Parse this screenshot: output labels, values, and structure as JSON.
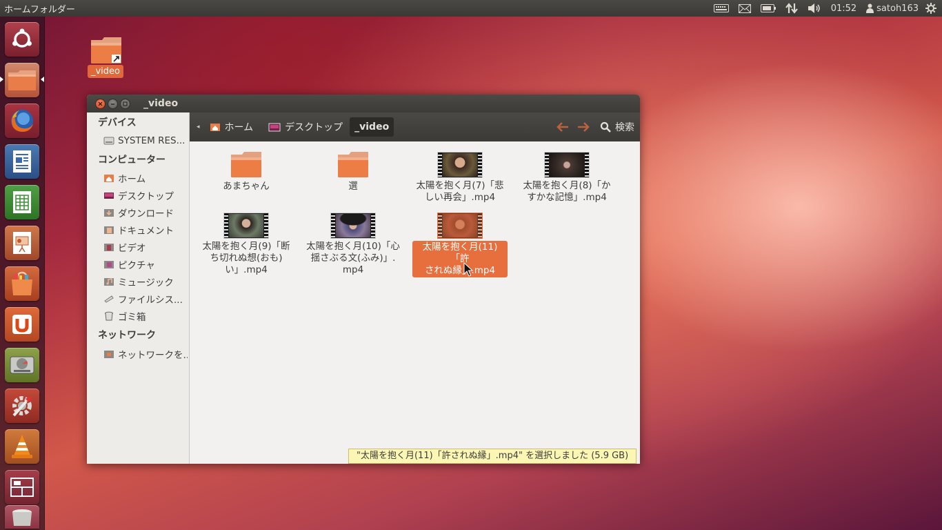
{
  "top_panel": {
    "app_title": "ホームフォルダー",
    "clock": "01:52",
    "user": "satoh163",
    "indicators": [
      "keyboard-icon",
      "mail-icon",
      "battery-icon",
      "network-icon",
      "volume-icon",
      "user-icon",
      "power-icon"
    ]
  },
  "launcher": {
    "items": [
      "dash-home",
      "home-folder",
      "firefox",
      "libreoffice-writer",
      "libreoffice-calc",
      "libreoffice-impress",
      "ubuntu-software-center",
      "ubuntu-one",
      "disk-utility",
      "system-settings",
      "vlc",
      "workspace-switcher",
      "trash"
    ]
  },
  "desktop": {
    "icon_label": "_video"
  },
  "window": {
    "title": "_video",
    "sidebar": {
      "devices_heading": "デバイス",
      "devices": [
        "SYSTEM RES..."
      ],
      "computer_heading": "コンピューター",
      "computer": [
        "ホーム",
        "デスクトップ",
        "ダウンロード",
        "ドキュメント",
        "ビデオ",
        "ピクチャ",
        "ミュージック",
        "ファイルシス...",
        "ゴミ箱"
      ],
      "network_heading": "ネットワーク",
      "network": [
        "ネットワークを..."
      ]
    },
    "toolbar": {
      "crumbs": [
        "ホーム",
        "デスクトップ",
        "_video"
      ],
      "search_label": "検索"
    },
    "files": [
      {
        "type": "folder",
        "name_lines": [
          "あまちゃん"
        ]
      },
      {
        "type": "folder",
        "name_lines": [
          "選"
        ]
      },
      {
        "type": "video",
        "name_lines": [
          "太陽を抱く月(7)「悲",
          "しい再会」.mp4"
        ]
      },
      {
        "type": "video",
        "name_lines": [
          "太陽を抱く月(8)「か",
          "すかな記憶」.mp4"
        ]
      },
      {
        "type": "video",
        "name_lines": [
          "太陽を抱く月(9)「断",
          "ち切れぬ想(おも)",
          "い」.mp4"
        ]
      },
      {
        "type": "video",
        "name_lines": [
          "太陽を抱く月(10)「心",
          "揺さぶる文(ふみ)」.",
          "mp4"
        ]
      },
      {
        "type": "video",
        "name_lines": [
          "太陽を抱く月(11)「許",
          "されぬ縁」.mp4"
        ],
        "selected": true
      }
    ],
    "status": "\"太陽を抱く月(11)「許されぬ縁」.mp4\" を選択しました (5.9 GB)"
  },
  "colors": {
    "accent": "#e76f3e",
    "panel": "#3c3b37",
    "window_bg": "#f2f1f0"
  }
}
